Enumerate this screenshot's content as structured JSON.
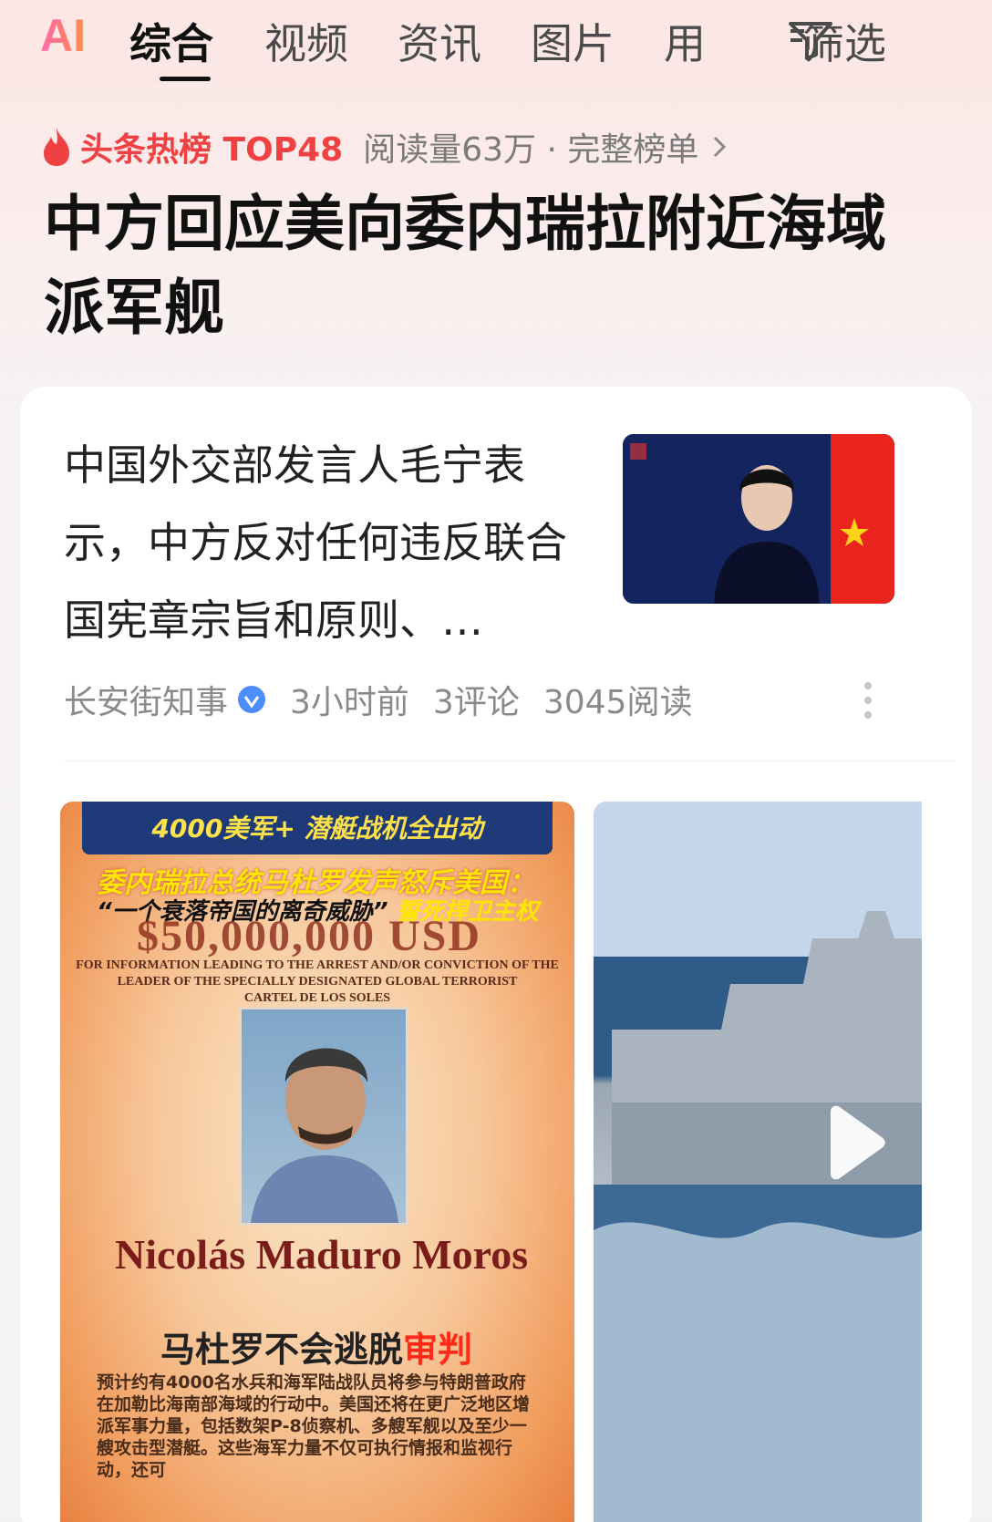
{
  "tabs": {
    "ai": "AI",
    "items": [
      "综合",
      "视频",
      "资讯",
      "图片",
      "用"
    ],
    "active": "综合",
    "filter_label": "筛选"
  },
  "hot": {
    "label": "头条热榜 TOP48",
    "meta": "阅读量63万 · 完整榜单"
  },
  "headline": "中方回应美向委内瑞拉附近海域派军舰",
  "article": {
    "summary": "中国外交部发言人毛宁表示，中方反对任何违反联合国宪章宗旨和原则、…",
    "source": "长安街知事",
    "time": "3小时前",
    "comments": "3评论",
    "reads": "3045阅读"
  },
  "video_main": {
    "banner": "4000美军+ 潜艇战机全出动",
    "line1": "委内瑞拉总统马杜罗发声怒斥美国：",
    "line2_a": "一个衰落帝国的离奇威胁",
    "line2_b": "誓死捍卫主权",
    "reward": "$50,000,000 USD",
    "small1": "FOR INFORMATION LEADING TO THE ARREST AND/OR CONVICTION OF THE",
    "small2": "LEADER OF THE SPECIALLY DESIGNATED GLOBAL TERRORIST",
    "small3": "CARTEL DE LOS SOLES",
    "name": "Nicolás Maduro Moros",
    "subtitle_a": "马杜罗不会逃脱",
    "subtitle_b": "审判",
    "body": "预计约有4000名水兵和海军陆战队员将参与特朗普政府在加勒比海南部海域的行动中。美国还将在更广泛地区增派军事力量，包括数架P-8侦察机、多艘军舰以及至少一艘攻击型潜艇。这些海军力量不仅可执行情报和监视行动，还可"
  },
  "colors": {
    "accent_red": "#f04142",
    "verified_blue": "#4b8dfb"
  }
}
